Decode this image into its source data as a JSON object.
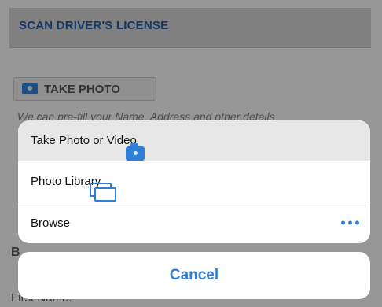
{
  "background": {
    "section_title": "SCAN DRIVER'S LICENSE",
    "take_photo_label": "TAKE PHOTO",
    "prefill_text": "We can pre-fill your Name, Address and other details",
    "partial_letter": "B",
    "first_name_label": "First Name:"
  },
  "action_sheet": {
    "options": [
      {
        "label": "Take Photo or Video",
        "icon": "camera-icon"
      },
      {
        "label": "Photo Library",
        "icon": "photo-library-icon"
      },
      {
        "label": "Browse",
        "icon": "more-icon"
      }
    ],
    "cancel_label": "Cancel"
  },
  "colors": {
    "accent": "#2f7fd8",
    "section_title": "#1f5aa6"
  }
}
